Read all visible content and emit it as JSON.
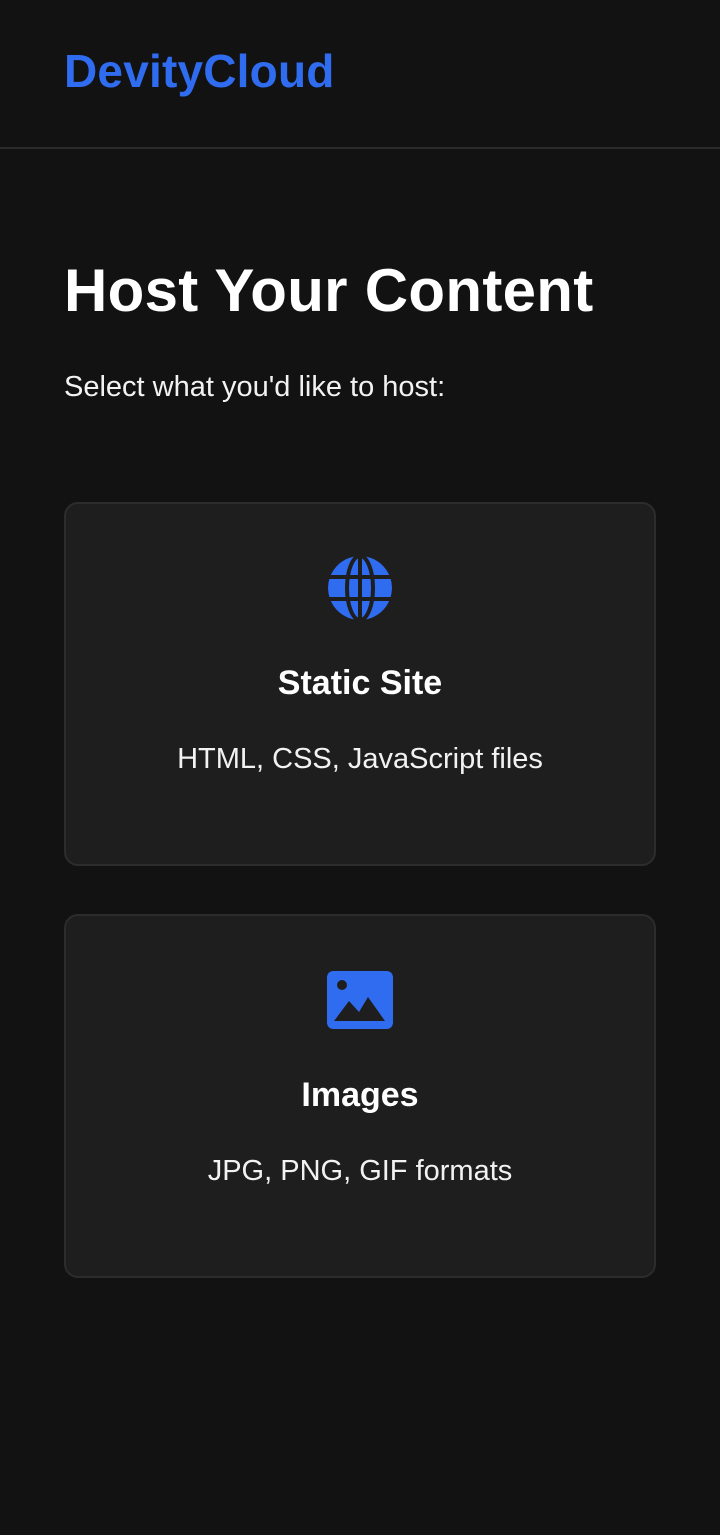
{
  "brand": {
    "name": "DevityCloud",
    "color": "#2f6cf0"
  },
  "page": {
    "title": "Host Your Content",
    "subtitle": "Select what you'd like to host:"
  },
  "options": [
    {
      "icon": "globe-icon",
      "title": "Static Site",
      "description": "HTML, CSS, JavaScript files"
    },
    {
      "icon": "image-icon",
      "title": "Images",
      "description": "JPG, PNG, GIF formats"
    }
  ],
  "colors": {
    "background": "#121212",
    "card": "#1e1e1e",
    "accent": "#2f6cf0"
  }
}
